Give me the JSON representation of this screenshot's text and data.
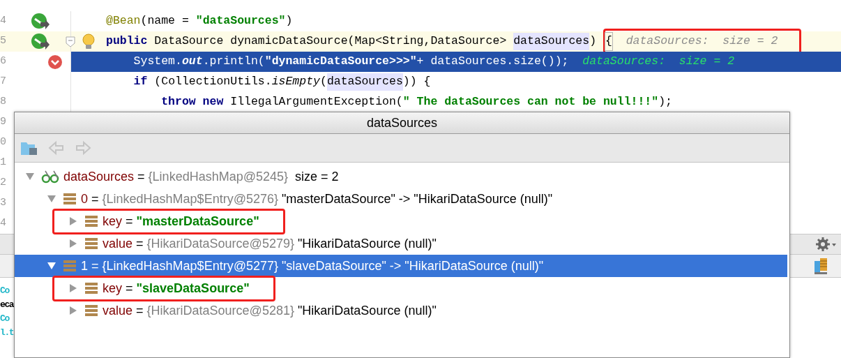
{
  "editor": {
    "lines": [
      {
        "number": "4",
        "kind": "normal",
        "gutter_icons": [
          {
            "kind": "bean"
          }
        ],
        "tokens": [
          {
            "kind": "annotation",
            "text": "@Bean"
          },
          {
            "kind": "plain",
            "text": "(name = "
          },
          {
            "kind": "string",
            "text": "\"dataSources\""
          },
          {
            "kind": "plain",
            "text": ")"
          }
        ]
      },
      {
        "number": "5",
        "kind": "caret",
        "gutter_icons": [
          {
            "kind": "bean"
          },
          {
            "kind": "fold"
          },
          {
            "kind": "bulb"
          }
        ],
        "tokens": [
          {
            "kind": "keyword",
            "text": "public"
          },
          {
            "kind": "plain",
            "text": " DataSource dynamicDataSource(Map<String,DataSource> "
          },
          {
            "kind": "param",
            "text": "dataSources"
          },
          {
            "kind": "plain",
            "text": ") "
          },
          {
            "kind": "brace",
            "text": "{",
            "framed": true
          },
          {
            "kind": "hint",
            "text": "  dataSources:  size = 2",
            "framed": true
          }
        ]
      },
      {
        "number": "6",
        "kind": "execution",
        "gutter_icons": [
          {
            "kind": "breakpoint"
          }
        ],
        "tokens": [
          {
            "kind": "plain",
            "text": "    System."
          },
          {
            "kind": "static",
            "text": "out"
          },
          {
            "kind": "plain",
            "text": ".println("
          },
          {
            "kind": "string",
            "text": "\"dynamicDataSource>>>\""
          },
          {
            "kind": "plain",
            "text": "+ dataSources.size());  "
          },
          {
            "kind": "hint",
            "text": "dataSources:  size = 2"
          }
        ]
      },
      {
        "number": "7",
        "kind": "normal",
        "tokens": [
          {
            "kind": "keyword",
            "text": "    if"
          },
          {
            "kind": "plain",
            "text": " (CollectionUtils."
          },
          {
            "kind": "method",
            "text": "isEmpty"
          },
          {
            "kind": "plain",
            "text": "("
          },
          {
            "kind": "param",
            "text": "dataSources"
          },
          {
            "kind": "plain",
            "text": ")) {"
          }
        ]
      },
      {
        "number": "8",
        "kind": "normal",
        "tokens": [
          {
            "kind": "keyword",
            "text": "        throw new"
          },
          {
            "kind": "plain",
            "text": " IllegalArgumentException("
          },
          {
            "kind": "string",
            "text": "\" The dataSources can not be null!!!\""
          },
          {
            "kind": "plain",
            "text": ");"
          }
        ]
      },
      {
        "number": "9",
        "kind": "normal"
      },
      {
        "number": "0",
        "kind": "normal"
      },
      {
        "number": "1",
        "kind": "normal"
      },
      {
        "number": "2",
        "kind": "normal"
      },
      {
        "number": "3",
        "kind": "normal"
      },
      {
        "number": "4",
        "kind": "normal"
      }
    ]
  },
  "console": {
    "lines": [
      {
        "text": "Co",
        "color": "#1fb6c8"
      },
      {
        "text": "eca",
        "color": "#000000"
      },
      {
        "text": "Co",
        "color": "#1fb6c8"
      },
      {
        "text": "l.t",
        "color": "#1fb6c8"
      }
    ]
  },
  "popup": {
    "title": "dataSources",
    "tree": [
      {
        "kind": "watch",
        "name": "dataSources",
        "sep": "=",
        "type_ref": "{LinkedHashMap@5245}",
        "value": " size = 2",
        "string_value": false,
        "expanded": true,
        "selected": false,
        "children": [
          {
            "kind": "field",
            "name": "0",
            "sep": "=",
            "type_ref": "{LinkedHashMap$Entry@5276}",
            "value": "\"masterDataSource\" -> \"HikariDataSource (null)\"",
            "string_value": false,
            "expanded": true,
            "selected": false,
            "children": [
              {
                "kind": "field",
                "name": "key",
                "sep": "=",
                "value": "\"masterDataSource\"",
                "string_value": true,
                "expanded": false,
                "selected": false,
                "framed": true
              },
              {
                "kind": "field",
                "name": "value",
                "sep": "=",
                "type_ref": "{HikariDataSource@5279}",
                "value": "\"HikariDataSource (null)\"",
                "string_value": false,
                "expanded": false,
                "selected": false
              }
            ]
          },
          {
            "kind": "field",
            "name": "1",
            "sep": "=",
            "type_ref": "{LinkedHashMap$Entry@5277}",
            "value": "\"slaveDataSource\" -> \"HikariDataSource (null)\"",
            "string_value": false,
            "expanded": true,
            "selected": true,
            "children": [
              {
                "kind": "field",
                "name": "key",
                "sep": "=",
                "value": "\"slaveDataSource\"",
                "string_value": true,
                "expanded": false,
                "selected": false,
                "framed": true
              },
              {
                "kind": "field",
                "name": "value",
                "sep": "=",
                "type_ref": "{HikariDataSource@5281}",
                "value": "\"HikariDataSource (null)\"",
                "string_value": false,
                "expanded": false,
                "selected": false
              }
            ]
          }
        ]
      }
    ]
  }
}
